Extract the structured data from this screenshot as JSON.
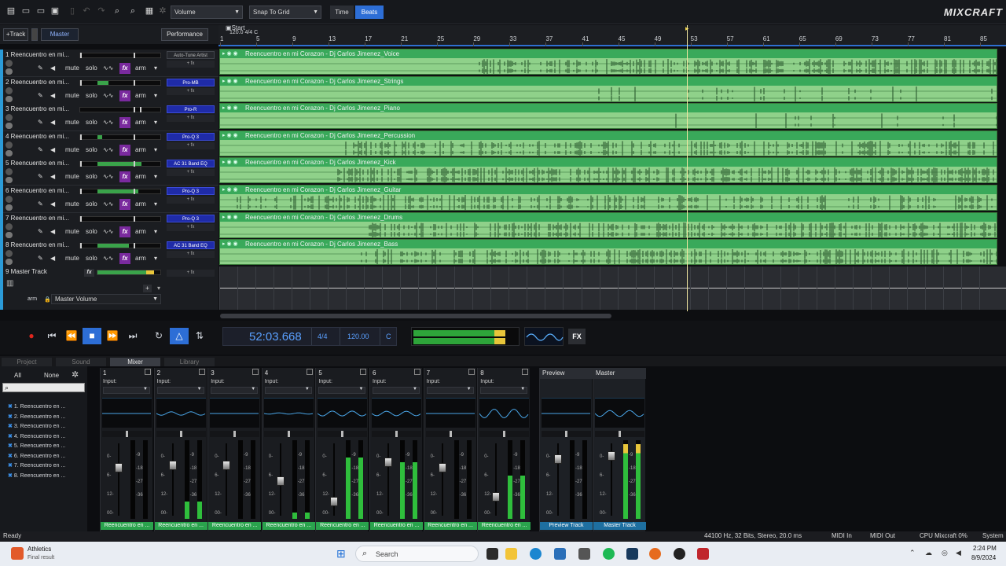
{
  "toolbar": {
    "volume_dropdown": "Volume",
    "snap_dropdown": "Snap To Grid",
    "time_label": "Time",
    "beats_label": "Beats",
    "logo": "MIXCRAFT"
  },
  "track_header": {
    "add_track": "+Track",
    "master": "Master",
    "performance": "Performance"
  },
  "ruler": {
    "start_label": "Start",
    "tempo_info": "120.0 4/4 C",
    "ticks": [
      "1",
      "5",
      "9",
      "13",
      "17",
      "21",
      "25",
      "29",
      "33",
      "37",
      "41",
      "45",
      "49",
      "53",
      "57",
      "61",
      "65",
      "69",
      "73",
      "77",
      "81",
      "85"
    ]
  },
  "tracks": [
    {
      "name": "1 Reencuentro en mi...",
      "plugin": "Auto-Tune Artist",
      "plugin_style": "neutral",
      "clip": "Reencuentro en mi Corazon - Dj Carlos Jimenez_Voice"
    },
    {
      "name": "2 Reencuentro en mi...",
      "plugin": "Pro-MB",
      "plugin_style": "blue",
      "clip": "Reencuentro en mi Corazon - Dj Carlos Jimenez_Strings"
    },
    {
      "name": "3 Reencuentro en mi...",
      "plugin": "Pro-R",
      "plugin_style": "blue",
      "clip": "Reencuentro en mi Corazon - Dj Carlos Jimenez_Piano"
    },
    {
      "name": "4 Reencuentro en mi...",
      "plugin": "Pro-Q 3",
      "plugin_style": "blue",
      "clip": "Reencuentro en mi Corazon - Dj Carlos Jimenez_Percussion"
    },
    {
      "name": "5 Reencuentro en mi...",
      "plugin": "AC 31 Band EQ",
      "plugin_style": "blue",
      "clip": "Reencuentro en mi Corazon - Dj Carlos Jimenez_Kick"
    },
    {
      "name": "6 Reencuentro en mi...",
      "plugin": "Pro-Q 3",
      "plugin_style": "blue",
      "clip": "Reencuentro en mi Corazon - Dj Carlos Jimenez_Guitar"
    },
    {
      "name": "7 Reencuentro en mi...",
      "plugin": "Pro-Q 3",
      "plugin_style": "blue",
      "clip": "Reencuentro en mi Corazon - Dj Carlos Jimenez_Drums"
    },
    {
      "name": "8 Reencuentro en mi...",
      "plugin": "AC 31 Band EQ",
      "plugin_style": "blue",
      "clip": "Reencuentro en mi Corazon - Dj Carlos Jimenez_Bass"
    }
  ],
  "track_controls": {
    "mute": "mute",
    "solo": "solo",
    "fx": "fx",
    "arm": "arm",
    "plus_fx": "+ fx"
  },
  "master_track": {
    "name": "9 Master Track",
    "fx": "fx",
    "arm": "arm",
    "automation": "Master Volume",
    "plus_fx": "+ fx"
  },
  "transport": {
    "time": "52:03.668",
    "signature": "4/4",
    "tempo": "120.00",
    "key": "C",
    "fx": "FX"
  },
  "tabs": [
    "Project",
    "Sound",
    "Mixer",
    "Library"
  ],
  "active_tab": "Mixer",
  "mixer_list": {
    "all": "All",
    "none": "None",
    "items": [
      "1. Reencuentro en ...",
      "2. Reencuentro en ...",
      "3. Reencuentro en ...",
      "4. Reencuentro en ...",
      "5. Reencuentro en ...",
      "6. Reencuentro en ...",
      "7. Reencuentro en ...",
      "8. Reencuentro en ..."
    ]
  },
  "strips": [
    {
      "num": "1",
      "input": "Input:",
      "label": "Reencuentro en ...",
      "level": 0.0
    },
    {
      "num": "2",
      "input": "Input:",
      "label": "Reencuentro en ...",
      "level": 0.22
    },
    {
      "num": "3",
      "input": "Input:",
      "label": "Reencuentro en ...",
      "level": 0.0
    },
    {
      "num": "4",
      "input": "Input:",
      "label": "Reencuentro en ...",
      "level": 0.08
    },
    {
      "num": "5",
      "input": "Input:",
      "label": "Reencuentro en ...",
      "level": 0.78
    },
    {
      "num": "6",
      "input": "Input:",
      "label": "Reencuentro en ...",
      "level": 0.72
    },
    {
      "num": "7",
      "input": "Input:",
      "label": "Reencuentro en ...",
      "level": 0.0
    },
    {
      "num": "8",
      "input": "Input:",
      "label": "Reencuentro en ...",
      "level": 0.55
    }
  ],
  "preview_strip": {
    "title": "Preview",
    "label": "Preview Track"
  },
  "master_strip": {
    "title": "Master",
    "label": "Master Track"
  },
  "fader_scale": [
    "0-",
    "6-",
    "12-",
    "00-"
  ],
  "meter_scale": [
    "-9",
    "-18",
    "-27",
    "-36"
  ],
  "status": {
    "ready": "Ready",
    "audio": "44100 Hz, 32 Bits, Stereo, 20.0 ms",
    "midi_in": "MIDI In",
    "midi_out": "MIDI Out",
    "cpu": "CPU Mixcraft 0%",
    "system": "System"
  },
  "taskbar": {
    "app_name": "Athletics",
    "app_sub": "Final result",
    "search": "Search",
    "time": "2:24 PM",
    "date": "8/9/2024"
  }
}
